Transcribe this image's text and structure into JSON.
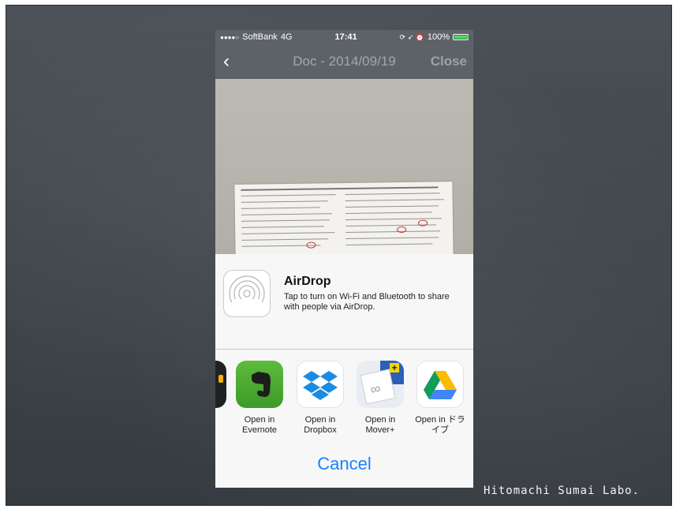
{
  "status_bar": {
    "signal": "●●●●○",
    "carrier": "SoftBank",
    "network": "4G",
    "time": "17:41",
    "icons": "⟳ ➶ ⏰",
    "battery": "100%",
    "battery_level": 1.0
  },
  "nav": {
    "back_icon": "‹",
    "title": "Doc - 2014/09/19",
    "close_label": "Close"
  },
  "share_sheet": {
    "airdrop_title": "AirDrop",
    "airdrop_desc": "Tap to turn on Wi-Fi and Bluetooth to share with people via AirDrop.",
    "apps": [
      {
        "icon": "app-partial-icon",
        "label": ""
      },
      {
        "icon": "evernote-icon",
        "label_line1": "Open in",
        "label_line2": "Evernote"
      },
      {
        "icon": "dropbox-icon",
        "label_line1": "Open in",
        "label_line2": "Dropbox"
      },
      {
        "icon": "mover-icon",
        "label_line1": "Open in",
        "label_line2": "Mover+"
      },
      {
        "icon": "google-drive-icon",
        "label_line1": "Open in ドラ",
        "label_line2": "イブ"
      }
    ],
    "cancel_label": "Cancel"
  },
  "watermark": "Hitomachi Sumai Labo.",
  "colors": {
    "accent": "#1a82fb",
    "navbar": "#5d6268",
    "evernote": "#4aa631",
    "dropbox": "#1c8ce3"
  }
}
